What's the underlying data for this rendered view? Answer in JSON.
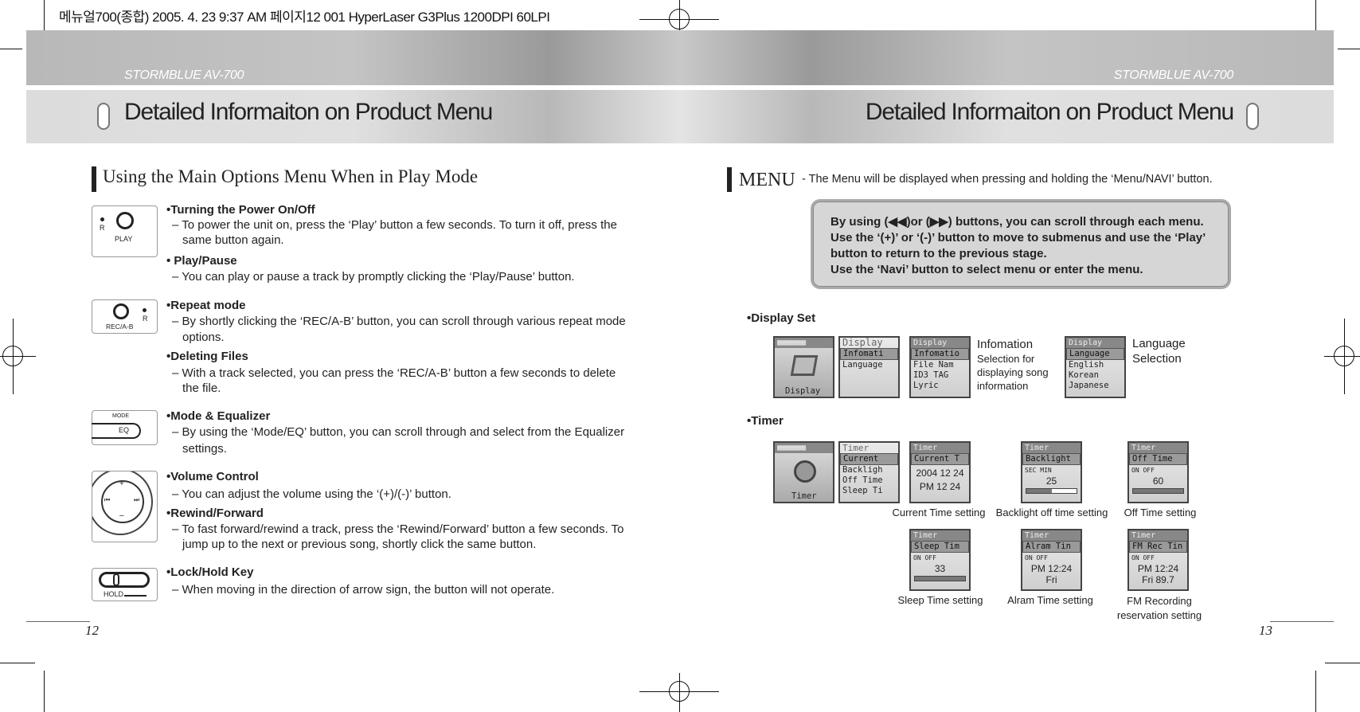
{
  "print_header": "메뉴얼700(종합)  2005. 4. 23 9:37 AM 페이지12   001 HyperLaser G3Plus 1200DPI 60LPI",
  "brand": "STORMBLUE AV-700",
  "page_title": "Detailed Informaiton on Product Menu",
  "left": {
    "section_title": "Using the Main Options Menu When in Play Mode",
    "icons": {
      "play": {
        "label": "PLAY",
        "dot": "R"
      },
      "rec": {
        "label": "REC/A-B",
        "dot": "R"
      },
      "mode": {
        "top": "MODE",
        "label": "EQ"
      },
      "volume": {
        "plus": "+",
        "minus": "–",
        "prev": "⏮",
        "next": "⏭"
      },
      "hold": {
        "label": "HOLD"
      }
    },
    "items": [
      {
        "title": "Turning the Power On/Off",
        "desc": [
          "To power the unit on, press the ‘Play’ button a few seconds. To turn it off, press the",
          "same button again."
        ]
      },
      {
        "title": "Play/Pause",
        "desc": [
          "You can play or pause a track by promptly clicking the ‘Play/Pause’ button."
        ]
      },
      {
        "title": "Repeat mode",
        "desc": [
          "By shortly clicking the ‘REC/A-B’ button, you can scroll through various repeat mode",
          "options."
        ]
      },
      {
        "title": "Deleting Files",
        "desc": [
          "With a track selected, you can press the ‘REC/A-B’ button a few seconds to delete",
          "the file."
        ]
      },
      {
        "title": "Mode & Equalizer",
        "desc": [
          "By using the ‘Mode/EQ’ button, you can scroll through and select from the Equalizer",
          "settings."
        ]
      },
      {
        "title": "Volume Control",
        "desc": [
          "You can adjust the volume using the ‘(+)/(-)’ button."
        ]
      },
      {
        "title": "Rewind/Forward",
        "desc": [
          "To fast forward/rewind a track, press the ‘Rewind/Forward’ button a few seconds. To",
          "jump up to the next or previous song, shortly click the same button."
        ]
      },
      {
        "title": "Lock/Hold Key",
        "desc": [
          "When moving in the direction of arrow sign, the button will not operate."
        ]
      }
    ],
    "page_number": "12"
  },
  "right": {
    "menu_word": "MENU",
    "menu_desc": "- The Menu will be displayed when pressing and holding the ‘Menu/NAVI’ button.",
    "box_lines": [
      "By using (◀◀)or (▶▶) buttons, you can scroll through each menu.",
      "Use the ‘(+)’ or ‘(-)’ button to move to submenus and use the ‘Play’",
      "button to return to the previous stage.",
      "Use the ‘Navi’ button to select menu or enter the menu."
    ],
    "display_set": {
      "heading": "Display Set",
      "screens": [
        {
          "title": "",
          "rows": [
            "",
            "",
            "",
            "Display"
          ]
        },
        {
          "title": "Display",
          "rows": [
            "Infomati",
            "Language"
          ]
        },
        {
          "title": "Display",
          "rows": [
            "Infomatio",
            "File Nam",
            "ID3 TAG",
            "Lyric"
          ]
        },
        {
          "title": "Display",
          "rows": [
            "Language",
            "English",
            "Korean",
            "Japanese"
          ]
        }
      ],
      "info_caption": [
        "Infomation",
        "Selection for",
        "displaying song",
        "information"
      ],
      "lang_caption": [
        "Language",
        "Selection"
      ]
    },
    "timer": {
      "heading": "Timer",
      "screens": [
        {
          "title": "",
          "rows": [
            "",
            "",
            "",
            "Timer"
          ],
          "caption": ""
        },
        {
          "title": "Timer",
          "rows": [
            "Current",
            "Backligh",
            "Off Time",
            "Sleep Ti"
          ],
          "caption": ""
        },
        {
          "title": "Timer",
          "rows": [
            "Current T",
            "2004 12 24",
            "PM 12 24"
          ],
          "caption": "Current Time setting"
        },
        {
          "title": "Timer",
          "rows": [
            "Backlight",
            "SEC  MIN",
            "25"
          ],
          "caption": "Backlight off time setting"
        },
        {
          "title": "Timer",
          "rows": [
            "Off Time",
            "ON  OFF",
            "60"
          ],
          "caption": "Off Time setting"
        },
        {
          "title": "Timer",
          "rows": [
            "Sleep Tim",
            "ON  OFF",
            "33"
          ],
          "caption": "Sleep Time setting"
        },
        {
          "title": "Timer",
          "rows": [
            "Alram Tin",
            "ON  OFF",
            "PM 12:24",
            "Fri"
          ],
          "caption": "Alram Time setting"
        },
        {
          "title": "Timer",
          "rows": [
            "FM Rec Tin",
            "ON  OFF",
            "PM 12:24",
            "Fri 89.7"
          ],
          "caption": "FM Recording reservation setting"
        }
      ],
      "backlight_level": 0.5
    },
    "page_number": "13"
  }
}
